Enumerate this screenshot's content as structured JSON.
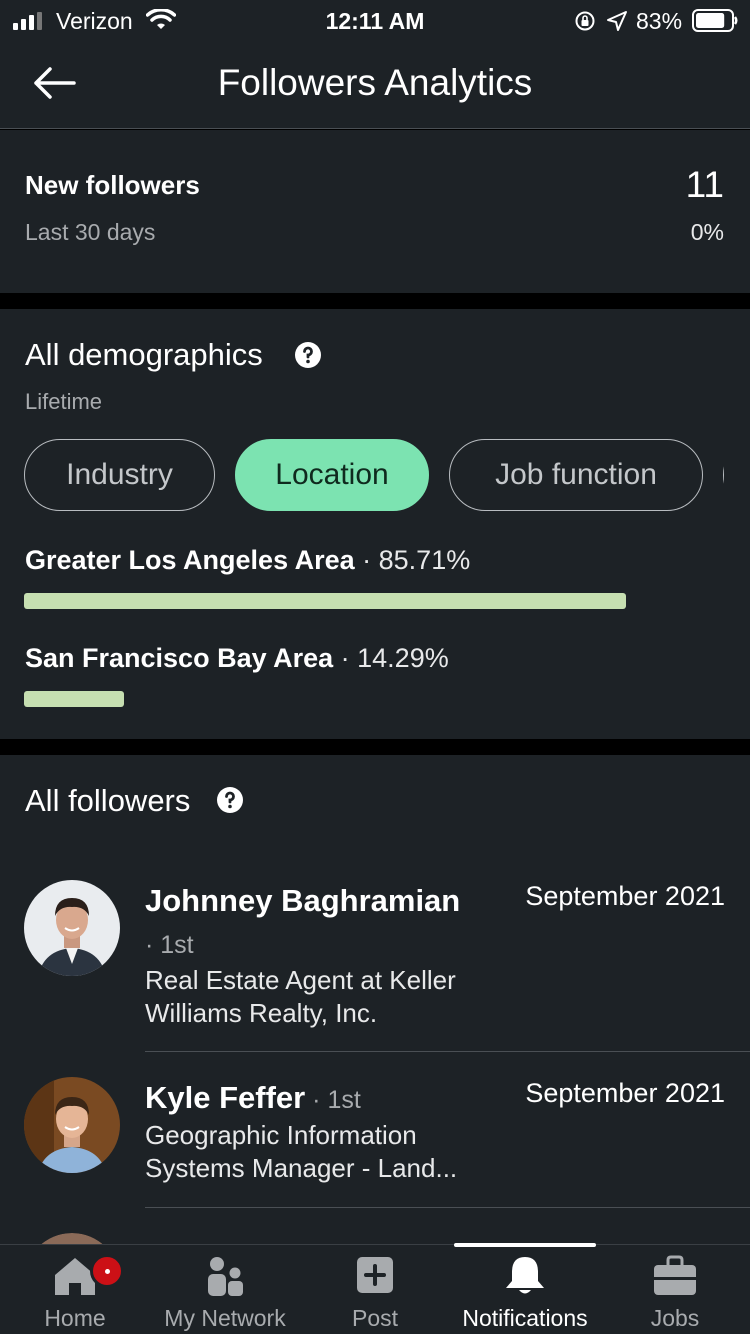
{
  "status_bar": {
    "carrier": "Verizon",
    "time": "12:11 AM",
    "battery_percent": "83%",
    "battery_level": 0.83,
    "icons": [
      "signal-icon",
      "wifi-icon",
      "rotation-lock-icon",
      "location-arrow-icon",
      "battery-icon"
    ]
  },
  "header": {
    "title": "Followers Analytics",
    "back_icon": "back-arrow-icon"
  },
  "new_followers": {
    "title": "New followers",
    "period": "Last 30 days",
    "count": "11",
    "change": "0%"
  },
  "demographics": {
    "title": "All demographics",
    "period": "Lifetime",
    "help_icon": "question-circle-icon",
    "filters": [
      {
        "label": "Industry",
        "active": false
      },
      {
        "label": "Location",
        "active": true
      },
      {
        "label": "Job function",
        "active": false
      }
    ],
    "locations": [
      {
        "name": "Greater Los Angeles Area",
        "separator": " · ",
        "percent": "85.71%",
        "share": 0.8571
      },
      {
        "name": "San Francisco Bay Area",
        "separator": " · ",
        "percent": "14.29%",
        "share": 0.1429
      }
    ]
  },
  "followers": {
    "title": "All followers",
    "help_icon": "question-circle-icon",
    "items": [
      {
        "name": "Johnney Baghramian",
        "degree": "· 1st",
        "description_line1": "Real Estate Agent at Keller",
        "description_line2": "Williams Realty, Inc.",
        "date": "September 2021"
      },
      {
        "name": "Kyle Feffer",
        "degree": " · 1st",
        "description_line1": "Geographic Information",
        "description_line2": "Systems Manager - Land...",
        "date": "September 2021"
      }
    ]
  },
  "tab_bar": {
    "tabs": [
      {
        "label": "Home",
        "icon": "home-icon",
        "active": false,
        "badge": true
      },
      {
        "label": "My Network",
        "icon": "network-icon",
        "active": false
      },
      {
        "label": "Post",
        "icon": "post-plus-icon",
        "active": false
      },
      {
        "label": "Notifications",
        "icon": "bell-icon",
        "active": true
      },
      {
        "label": "Jobs",
        "icon": "briefcase-icon",
        "active": false
      }
    ]
  },
  "colors": {
    "background": "#1d2226",
    "accent_pill": "#7ce3b1",
    "bar": "#c6dfb1",
    "badge": "#cc1016"
  }
}
